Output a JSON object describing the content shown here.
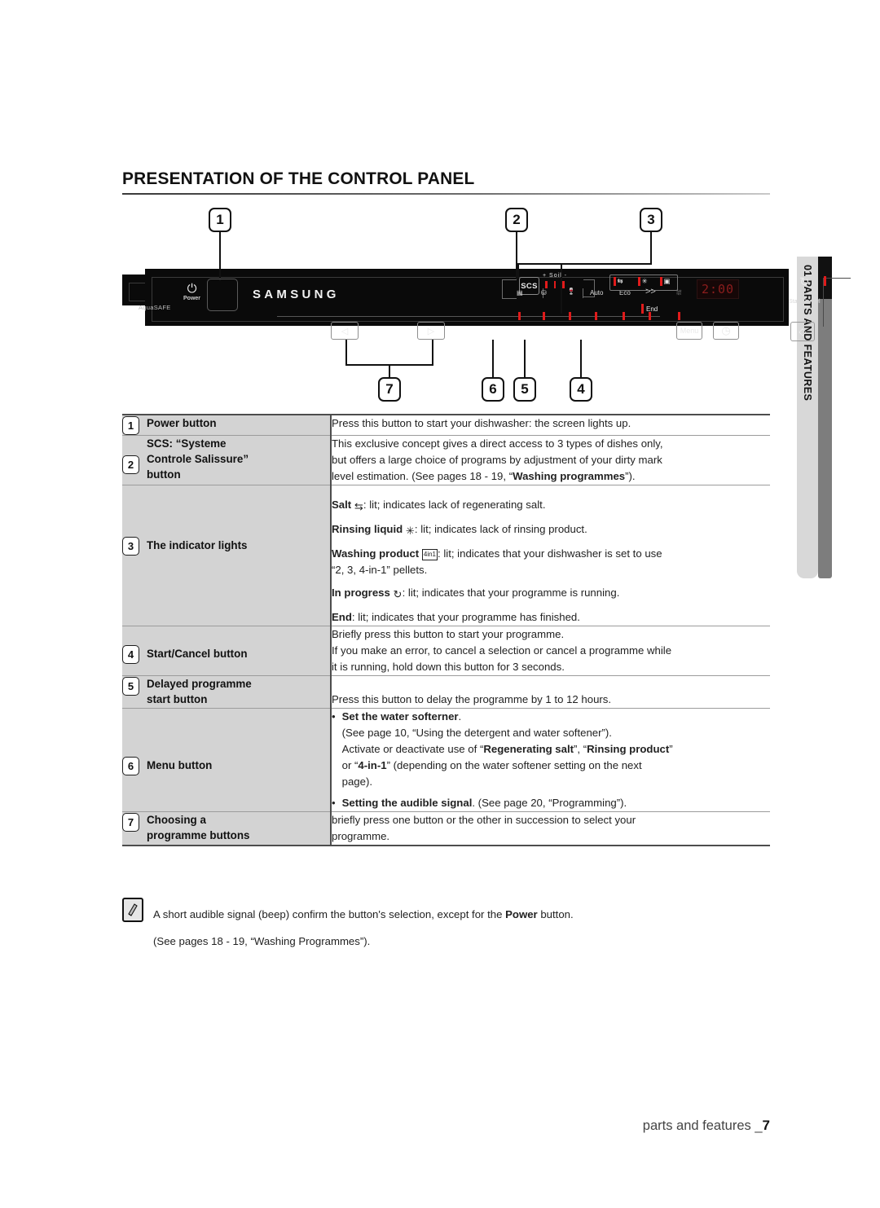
{
  "page": {
    "title": "PRESENTATION OF THE CONTROL PANEL",
    "footer_text": "parts and features _",
    "footer_page": "7",
    "side_tab": "01 PARTS AND FEATURES"
  },
  "panel": {
    "brand": "SAMSUNG",
    "aquasafe": "AquaSAFE",
    "power_label": "Power",
    "power_symbol": "⏻",
    "scs_label": "SCS",
    "soil_label": "+ Soil -",
    "soil_ticks": 3,
    "programmes": [
      "Auto",
      "Eco",
      ">>"
    ],
    "display_value": "2:00",
    "end_label": "End",
    "menu_label": "Menu",
    "start_cancel_label": "Start/Cancel",
    "nav_prev": "◁",
    "nav_next": "▷",
    "delay_symbol": "◷",
    "start_symbol": "◇",
    "in_progress_symbol": "↻",
    "indicator_icons": [
      "salt-icon",
      "rinse-aid-icon",
      "four-in-one-icon"
    ]
  },
  "callouts": [
    {
      "id": "1",
      "label": "1"
    },
    {
      "id": "2",
      "label": "2"
    },
    {
      "id": "3",
      "label": "3"
    },
    {
      "id": "4",
      "label": "4"
    },
    {
      "id": "5",
      "label": "5"
    },
    {
      "id": "6",
      "label": "6"
    },
    {
      "id": "7",
      "label": "7"
    }
  ],
  "table": {
    "rows": [
      {
        "num": "1",
        "label": "Power button",
        "lines": [
          "Press this button to start your dishwasher: the screen lights up."
        ]
      },
      {
        "num": "2",
        "label_line1": "SCS: “Systeme",
        "label_line2": "Controle Salissure”",
        "label_line3": "button",
        "p1": "This exclusive concept gives a direct access to 3 types of dishes only,",
        "p2": "but offers a large choice of programs by adjustment of your dirty mark",
        "p3_a": "level estimation. (See pages 18 - 19, “",
        "p3_b": "Washing programmes",
        "p3_c": "”)."
      },
      {
        "num": "3",
        "label": "The indicator lights",
        "salt_bold": "Salt",
        "salt_rest": ": lit; indicates lack of regenerating salt.",
        "rinse_bold": "Rinsing liquid",
        "rinse_rest": ": lit; indicates lack of rinsing product.",
        "wash_bold": "Washing product",
        "wash_rest": ": lit; indicates that your dishwasher is set to use",
        "wash_rest2": "“2, 3, 4-in-1” pellets.",
        "prog_bold": "In progress",
        "prog_rest": ": lit; indicates that your programme is running.",
        "end_bold": "End",
        "end_rest": ": lit; indicates that your programme has finished."
      },
      {
        "num": "4",
        "label": "Start/Cancel button",
        "p1": "Briefly press this button to start your programme.",
        "p2": "If you make an error, to cancel a selection or cancel a programme while",
        "p3": "it is running, hold down this button for 3 seconds."
      },
      {
        "num": "5",
        "label_line1": "Delayed programme",
        "label_line2": "start button",
        "p1": "Press this button to delay the programme by 1 to 12 hours."
      },
      {
        "num": "6",
        "label": "Menu button",
        "b1_bold": "Set the water softerner",
        "b1_dot": ".",
        "b1_l2": "(See page 10, “Using the detergent and water softener”).",
        "b1_l3_a": "Activate or deactivate use of “",
        "b1_l3_b": "Regenerating salt",
        "b1_l3_c": "”, “",
        "b1_l3_d": "Rinsing product",
        "b1_l3_e": "”",
        "b1_l4_a": "or “",
        "b1_l4_b": "4-in-1",
        "b1_l4_c": "” (depending on the water softener setting on the next",
        "b1_l5": "page).",
        "b2_bold": "Setting the audible signal",
        "b2_rest": ". (See page 20, “Programming”)."
      },
      {
        "num": "7",
        "label_line1": "Choosing a",
        "label_line2": "programme buttons",
        "p1": "briefly press one button or the other in succession to select your",
        "p2": "programme."
      }
    ]
  },
  "note": {
    "line1_a": "A short audible signal (beep) confirm the button's selection, except for the ",
    "line1_b": "Power",
    "line1_c": " button.",
    "line2": "(See pages 18 - 19, “Washing Programmes”)."
  }
}
